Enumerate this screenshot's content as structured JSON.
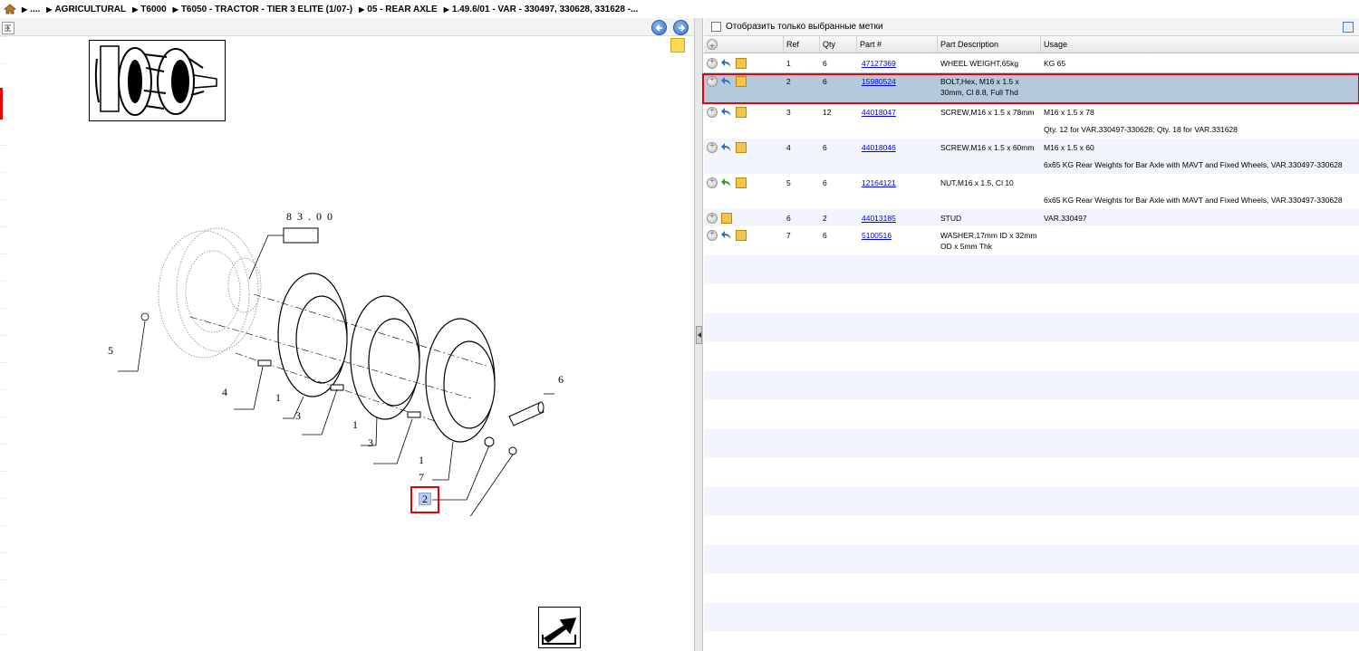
{
  "breadcrumb": {
    "items": [
      "....",
      "AGRICULTURAL",
      "T6000",
      "T6050 - TRACTOR - TIER 3 ELITE (1/07-)",
      "05 - REAR AXLE",
      "1.49.6/01 - VAR - 330497, 330628, 331628 -..."
    ]
  },
  "diagram": {
    "frame_label": "83.00",
    "callouts": [
      "5",
      "4",
      "1",
      "3",
      "1",
      "3",
      "1",
      "7",
      "6"
    ],
    "highlighted_ref": "2"
  },
  "filter": {
    "label": "Отобразить только выбранные метки"
  },
  "grid": {
    "columns": [
      "Ref",
      "Qty",
      "Part #",
      "Part Description",
      "Usage"
    ],
    "rows": [
      {
        "ref": "1",
        "qty": "6",
        "part": "47127369",
        "desc": "WHEEL WEIGHT,65kg",
        "usage": "KG 65",
        "note": ""
      },
      {
        "ref": "2",
        "qty": "6",
        "part": "15980524",
        "desc": "BOLT,Hex, M16 x 1.5 x 30mm, Cl 8.8, Full Thd",
        "usage": "",
        "note": ""
      },
      {
        "ref": "3",
        "qty": "12",
        "part": "44018047",
        "desc": "SCREW,M16 x 1.5 x 78mm",
        "usage": "M16 x 1.5 x 78",
        "note": "Qty. 12 for VAR.330497-330628; Qty. 18 for VAR.331628"
      },
      {
        "ref": "4",
        "qty": "6",
        "part": "44018046",
        "desc": "SCREW,M16 x 1.5 x 60mm",
        "usage": "M16 x 1.5 x 60",
        "note": "6x65 KG Rear Weights for Bar Axle with MAVT and Fixed Wheels, VAR.330497-330628"
      },
      {
        "ref": "5",
        "qty": "6",
        "part": "12164121",
        "desc": "NUT,M16 x 1.5, Cl 10",
        "usage": "",
        "note": "6x65 KG Rear Weights for Bar Axle with MAVT and Fixed Wheels, VAR.330497-330628"
      },
      {
        "ref": "6",
        "qty": "2",
        "part": "44013185",
        "desc": "STUD",
        "usage": "VAR.330497",
        "note": ""
      },
      {
        "ref": "7",
        "qty": "6",
        "part": "5100516",
        "desc": "WASHER,17mm ID x 32mm OD x 5mm Thk",
        "usage": "",
        "note": ""
      }
    ]
  },
  "colors": {
    "selected_row": "#b4c9dc",
    "highlight_frame": "#e00000",
    "link": "#0000ee"
  }
}
